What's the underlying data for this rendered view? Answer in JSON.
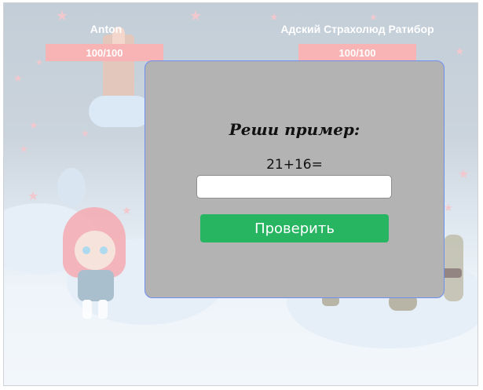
{
  "players": [
    {
      "name": "Anton",
      "hp_text": "100/100",
      "hp_fraction": 1.0
    },
    {
      "name": "Адский Страхолюд Ратибор",
      "hp_text": "100/100",
      "hp_fraction": 1.0
    }
  ],
  "modal": {
    "title": "Реши пример:",
    "problem": "21+16=",
    "answer_value": "",
    "check_label": "Проверить"
  },
  "colors": {
    "hp_bar": "#f8b4b4",
    "check_button": "#27b562",
    "modal_bg": "#b3b3b3",
    "modal_border": "#6f8ff0"
  },
  "icons": [
    "star-icon",
    "castle-icon",
    "girl-character",
    "monster-character"
  ]
}
